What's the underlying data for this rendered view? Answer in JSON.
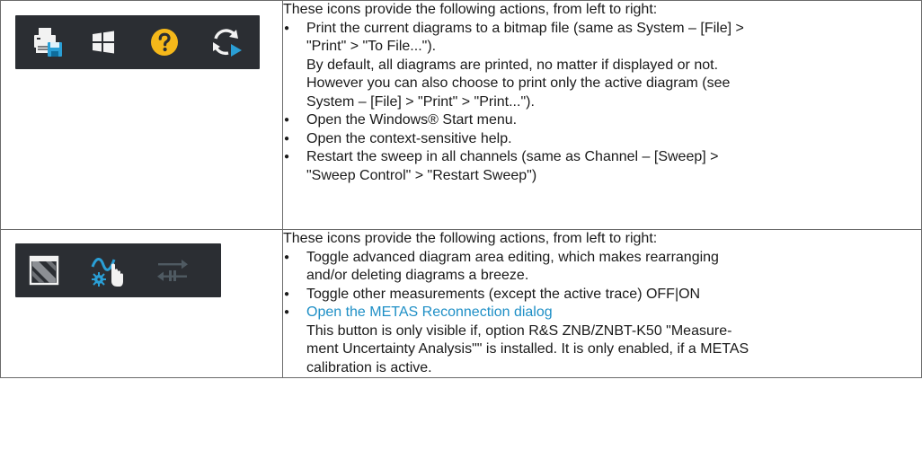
{
  "row1": {
    "intro": "These icons provide the following actions, from left to right:",
    "icons": [
      "print-icon",
      "windows-icon",
      "help-icon",
      "restart-sweep-icon"
    ],
    "items": [
      {
        "lines": [
          "Print the current diagrams to a bitmap file (same as System – [File] >",
          "\"Print\" > \"To File...\")."
        ],
        "extra": [
          "By default, all diagrams are printed, no matter if displayed or not.",
          "However you can also choose to print only the active diagram (see",
          "System – [File] > \"Print\" > \"Print...\")."
        ]
      },
      {
        "lines": [
          "Open the Windows® Start menu."
        ]
      },
      {
        "lines": [
          "Open the context-sensitive help."
        ]
      },
      {
        "lines": [
          "Restart the sweep in all channels (same as Channel – [Sweep] >",
          "\"Sweep Control\" > \"Restart Sweep\")"
        ]
      }
    ]
  },
  "row2": {
    "intro": "These icons provide the following actions, from left to right:",
    "icons": [
      "diagram-area-editing-icon",
      "toggle-measurements-icon",
      "metas-reconnection-icon"
    ],
    "items": [
      {
        "lines": [
          "Toggle advanced diagram area editing, which makes rearranging",
          "and/or deleting diagrams a breeze."
        ]
      },
      {
        "lines": [
          "Toggle other measurements (except the active trace) OFF|ON"
        ]
      },
      {
        "link": "Open the METAS Reconnection dialog",
        "extra": [
          "This button is only visible if, option R&S ZNB/ZNBT-K50 \"Measure-",
          "ment Uncertainty Analysis\"\" is installed. It is only enabled, if a METAS",
          "calibration is active."
        ]
      }
    ]
  },
  "colors": {
    "icon_bar": "#2b2e33",
    "help_yellow": "#f5b81a",
    "accent_blue": "#2a9fd6",
    "link": "#1e8fc6"
  }
}
